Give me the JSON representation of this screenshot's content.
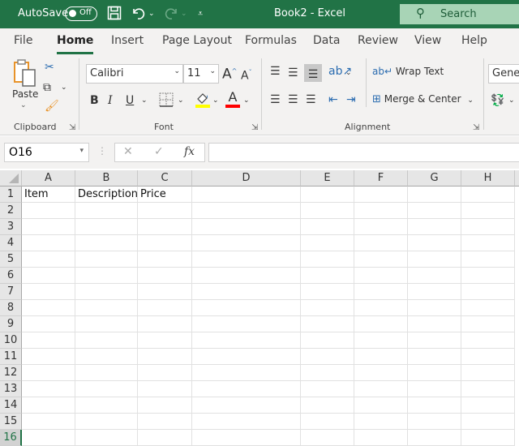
{
  "titlebar": {
    "autosave_label": "AutoSave",
    "autosave_state": "Off",
    "title": "Book2  -  Excel",
    "search_placeholder": "Search",
    "icons": [
      "save-icon",
      "undo-icon",
      "redo-icon",
      "customize-qat-icon"
    ]
  },
  "tabs": [
    {
      "label": "File",
      "active": false
    },
    {
      "label": "Home",
      "active": true
    },
    {
      "label": "Insert",
      "active": false
    },
    {
      "label": "Page Layout",
      "active": false
    },
    {
      "label": "Formulas",
      "active": false
    },
    {
      "label": "Data",
      "active": false
    },
    {
      "label": "Review",
      "active": false
    },
    {
      "label": "View",
      "active": false
    },
    {
      "label": "Help",
      "active": false
    }
  ],
  "ribbon": {
    "clipboard": {
      "label": "Clipboard",
      "paste_label": "Paste"
    },
    "font": {
      "label": "Font",
      "font_name": "Calibri",
      "font_size": "11",
      "bold": "B",
      "italic": "I",
      "underline": "U",
      "grow": "A",
      "shrink": "A",
      "font_color": "A"
    },
    "alignment": {
      "label": "Alignment",
      "wrap_text": "Wrap Text",
      "merge_center": "Merge & Center"
    },
    "number": {
      "format": "General"
    },
    "colors": {
      "fill_highlight": "#ffff00",
      "font_color": "#ff0000",
      "accent": "#217346"
    }
  },
  "formula_bar": {
    "name_box": "O16",
    "fx_label": "fx",
    "formula": ""
  },
  "sheet": {
    "columns": [
      "A",
      "B",
      "C",
      "D",
      "E",
      "F",
      "G",
      "H"
    ],
    "rows": [
      "1",
      "2",
      "3",
      "4",
      "5",
      "6",
      "7",
      "8",
      "9",
      "10",
      "11",
      "12",
      "13",
      "14",
      "15",
      "16"
    ],
    "selected_row": "16",
    "cells": {
      "A1": "Item",
      "B1": "Description",
      "C1": "Price"
    }
  }
}
